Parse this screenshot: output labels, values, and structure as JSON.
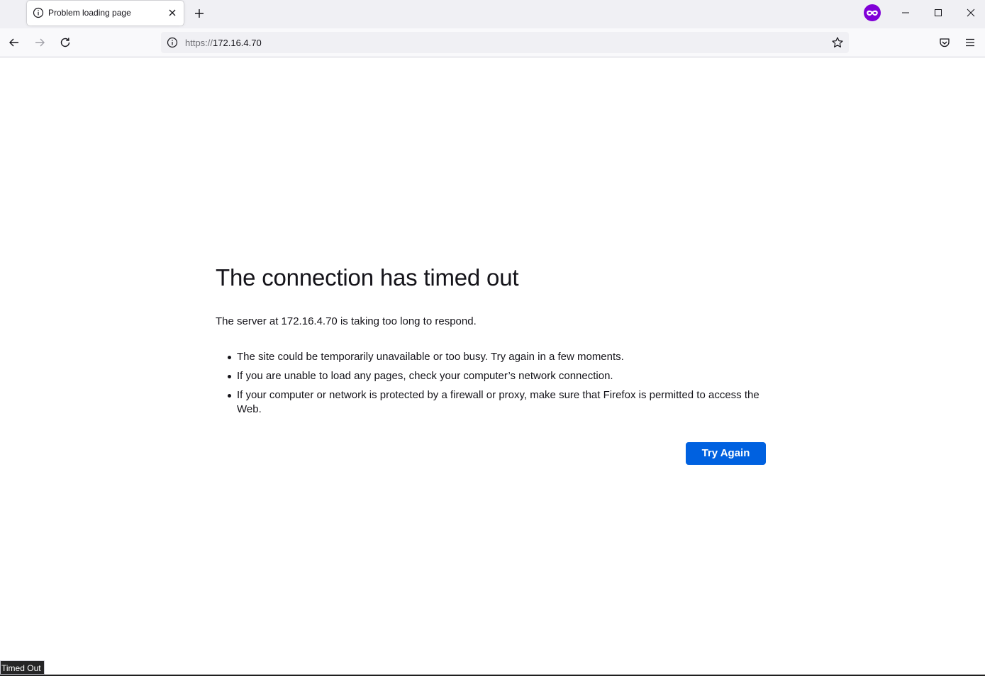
{
  "browser": {
    "tab": {
      "title": "Problem loading page",
      "icon": "info-icon"
    },
    "url": {
      "scheme": "https://",
      "host": "172.16.4.70"
    },
    "extension_color": "#8000d7",
    "accent_color": "#0061e0"
  },
  "error_page": {
    "title": "The connection has timed out",
    "description": "The server at 172.16.4.70 is taking too long to respond.",
    "items": [
      "The site could be temporarily unavailable or too busy. Try again in a few moments.",
      "If you are unable to load any pages, check your computer’s network connection.",
      "If your computer or network is protected by a firewall or proxy, make sure that Firefox is permitted to access the Web."
    ],
    "try_again_label": "Try Again"
  },
  "status_panel": {
    "text": "Timed Out"
  }
}
